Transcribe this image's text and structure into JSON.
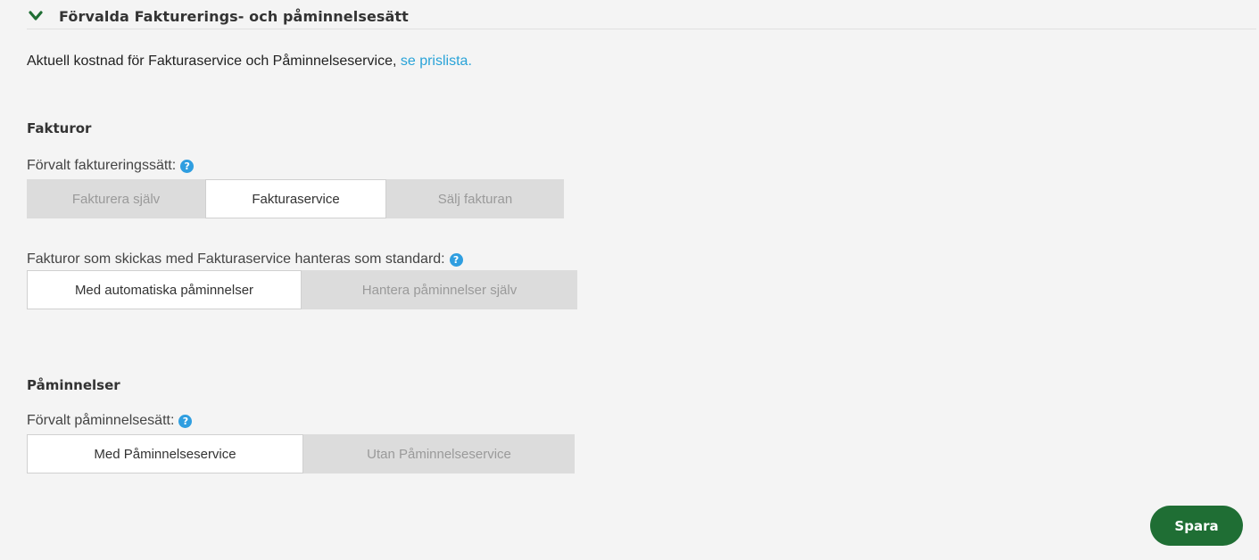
{
  "section": {
    "title": "Förvalda Fakturerings- och påminnelsesätt",
    "toggle_icon": "chevron-down-icon",
    "accent_color": "#1f6e34"
  },
  "intro": {
    "text": "Aktuell kostnad för Fakturaservice och Påminnelseservice,",
    "link_text": "se prislista.",
    "link_color": "#29a3d8"
  },
  "invoices": {
    "title": "Fakturor",
    "method_label": "Förvalt faktureringssätt:",
    "method_options": [
      "Fakturera själv",
      "Fakturaservice",
      "Sälj fakturan"
    ],
    "method_selected": "Fakturaservice",
    "handling_label": "Fakturor som skickas med Fakturaservice hanteras som standard:",
    "handling_options": [
      "Med automatiska påminnelser",
      "Hantera påminnelser själv"
    ],
    "handling_selected": "Med automatiska påminnelser"
  },
  "reminders": {
    "title": "Påminnelser",
    "method_label": "Förvalt påminnelsesätt:",
    "method_options": [
      "Med Påminnelseservice",
      "Utan Påminnelseservice"
    ],
    "method_selected": "Med Påminnelseservice"
  },
  "help_icon": "question-circle-icon",
  "help_glyph": "?",
  "save_label": "Spara"
}
